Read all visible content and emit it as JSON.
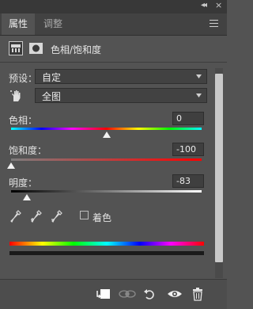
{
  "titlebar": {
    "collapse_glyph": "◂◂",
    "close_glyph": "×"
  },
  "tabs": [
    {
      "label": "属性",
      "active": true
    },
    {
      "label": "调整",
      "active": false
    }
  ],
  "panel": {
    "title": "色相/饱和度",
    "icon_1": "adjustment-layer-icon",
    "icon_2": "mask-icon"
  },
  "preset": {
    "label": "预设：",
    "value": "自定"
  },
  "channel": {
    "value": "全图",
    "icon": "hand-target-icon"
  },
  "sliders": {
    "hue": {
      "label": "色相：",
      "value": "0",
      "min": -180,
      "max": 180
    },
    "saturation": {
      "label": "饱和度：",
      "value": "-100",
      "min": -100,
      "max": 100
    },
    "lightness": {
      "label": "明度：",
      "value": "-83",
      "min": -100,
      "max": 100
    }
  },
  "colorize": {
    "label": "着色",
    "checked": false
  },
  "eyedroppers": [
    "eyedropper-icon",
    "eyedropper-add-icon",
    "eyedropper-subtract-icon"
  ],
  "footer_buttons": [
    "clip-to-layer-icon",
    "view-previous-state-icon",
    "reset-icon",
    "visibility-eye-icon",
    "trash-icon"
  ],
  "colors": {
    "panel_bg": "#535353",
    "active_tab": "#535353",
    "inactive_tab": "#424242"
  }
}
